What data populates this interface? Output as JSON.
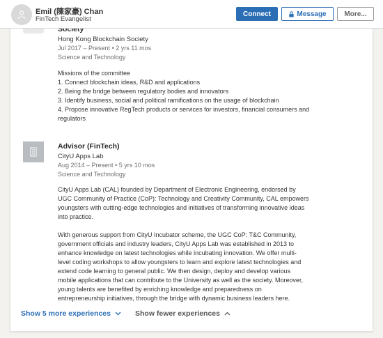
{
  "profile": {
    "name": "Emil (陳家豪) Chan",
    "headline": "FinTech Evangelist"
  },
  "actions": {
    "connect": "Connect",
    "message": "Message",
    "more": "More..."
  },
  "experiences": [
    {
      "title": "Society",
      "company": "Hong Kong Blockchain Society",
      "dates": "Jul 2017 – Present",
      "duration": "2 yrs 11 mos",
      "category": "Science and Technology",
      "description_lines": [
        "Missions of the committee",
        "1. Connect blockchain ideas, R&D and applications",
        "2. Being the bridge between regulatory bodies and innovators",
        "3. Identify business, social and political ramifications on the usage of blockchain",
        "4. Propose innovative RegTech products or services for investors, financial consumers and",
        "regulators"
      ]
    },
    {
      "title": "Advisor (FinTech)",
      "company": "CityU Apps Lab",
      "dates": "Aug 2014 – Present",
      "duration": "5 yrs 10 mos",
      "category": "Science and Technology",
      "description_lines": [
        "CityU Apps Lab (CAL) founded by Department of Electronic Engineering, endorsed by",
        "UGC Community of Practice (CoP): Technology and Creativity Community, CAL empowers",
        "youngsters with cutting-edge technologies and initiatives of transforming innovative ideas",
        "into practice.",
        "",
        "With generous support from CityU Incubator scheme, the UGC CoP: T&C Community,",
        "government officials and industry leaders, CityU Apps Lab was established in 2013 to",
        "enhance knowledge on latest technologies while incubating innovation. We offer multi-",
        "level coding workshops to allow youngsters to learn and explore latest technologies and",
        "extend code learning to general public. We then design, deploy and develop various",
        "mobile applications that can contribute to the University as well as the society. Moreover,",
        "young talents are benefited by enriching knowledge and preparedness on",
        "entrepreneurship initiatives, through the bridge with dynamic business leaders here."
      ]
    }
  ],
  "footer": {
    "show_more": "Show 5 more experiences",
    "show_fewer": "Show fewer experiences"
  },
  "colors": {
    "accent": "#2c6eb5",
    "meta_text": "#6e6e6e"
  },
  "icons": [
    "person-icon",
    "lock-icon",
    "company-logo-icon",
    "chevron-down-icon",
    "chevron-up-icon"
  ]
}
